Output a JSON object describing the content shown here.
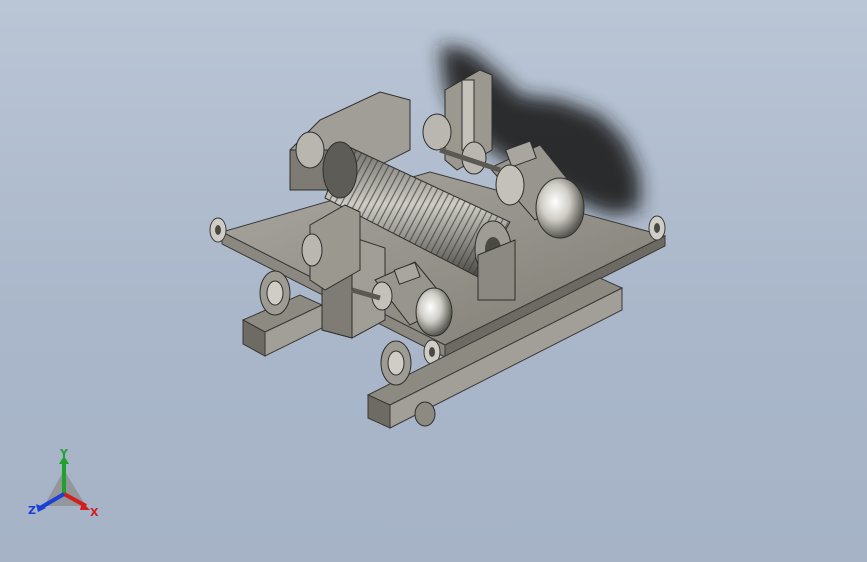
{
  "viewport": {
    "background_top": "#bac6d6",
    "background_bottom": "#a6b3c7",
    "model_color": "#8f8c84",
    "shadow_color": "#1c1c1c"
  },
  "triad": {
    "y_label": "Y",
    "x_label": "X",
    "z_label": "Z",
    "y_color": "#1fa12b",
    "x_color": "#d21e1e",
    "z_color": "#1c3fd6"
  }
}
